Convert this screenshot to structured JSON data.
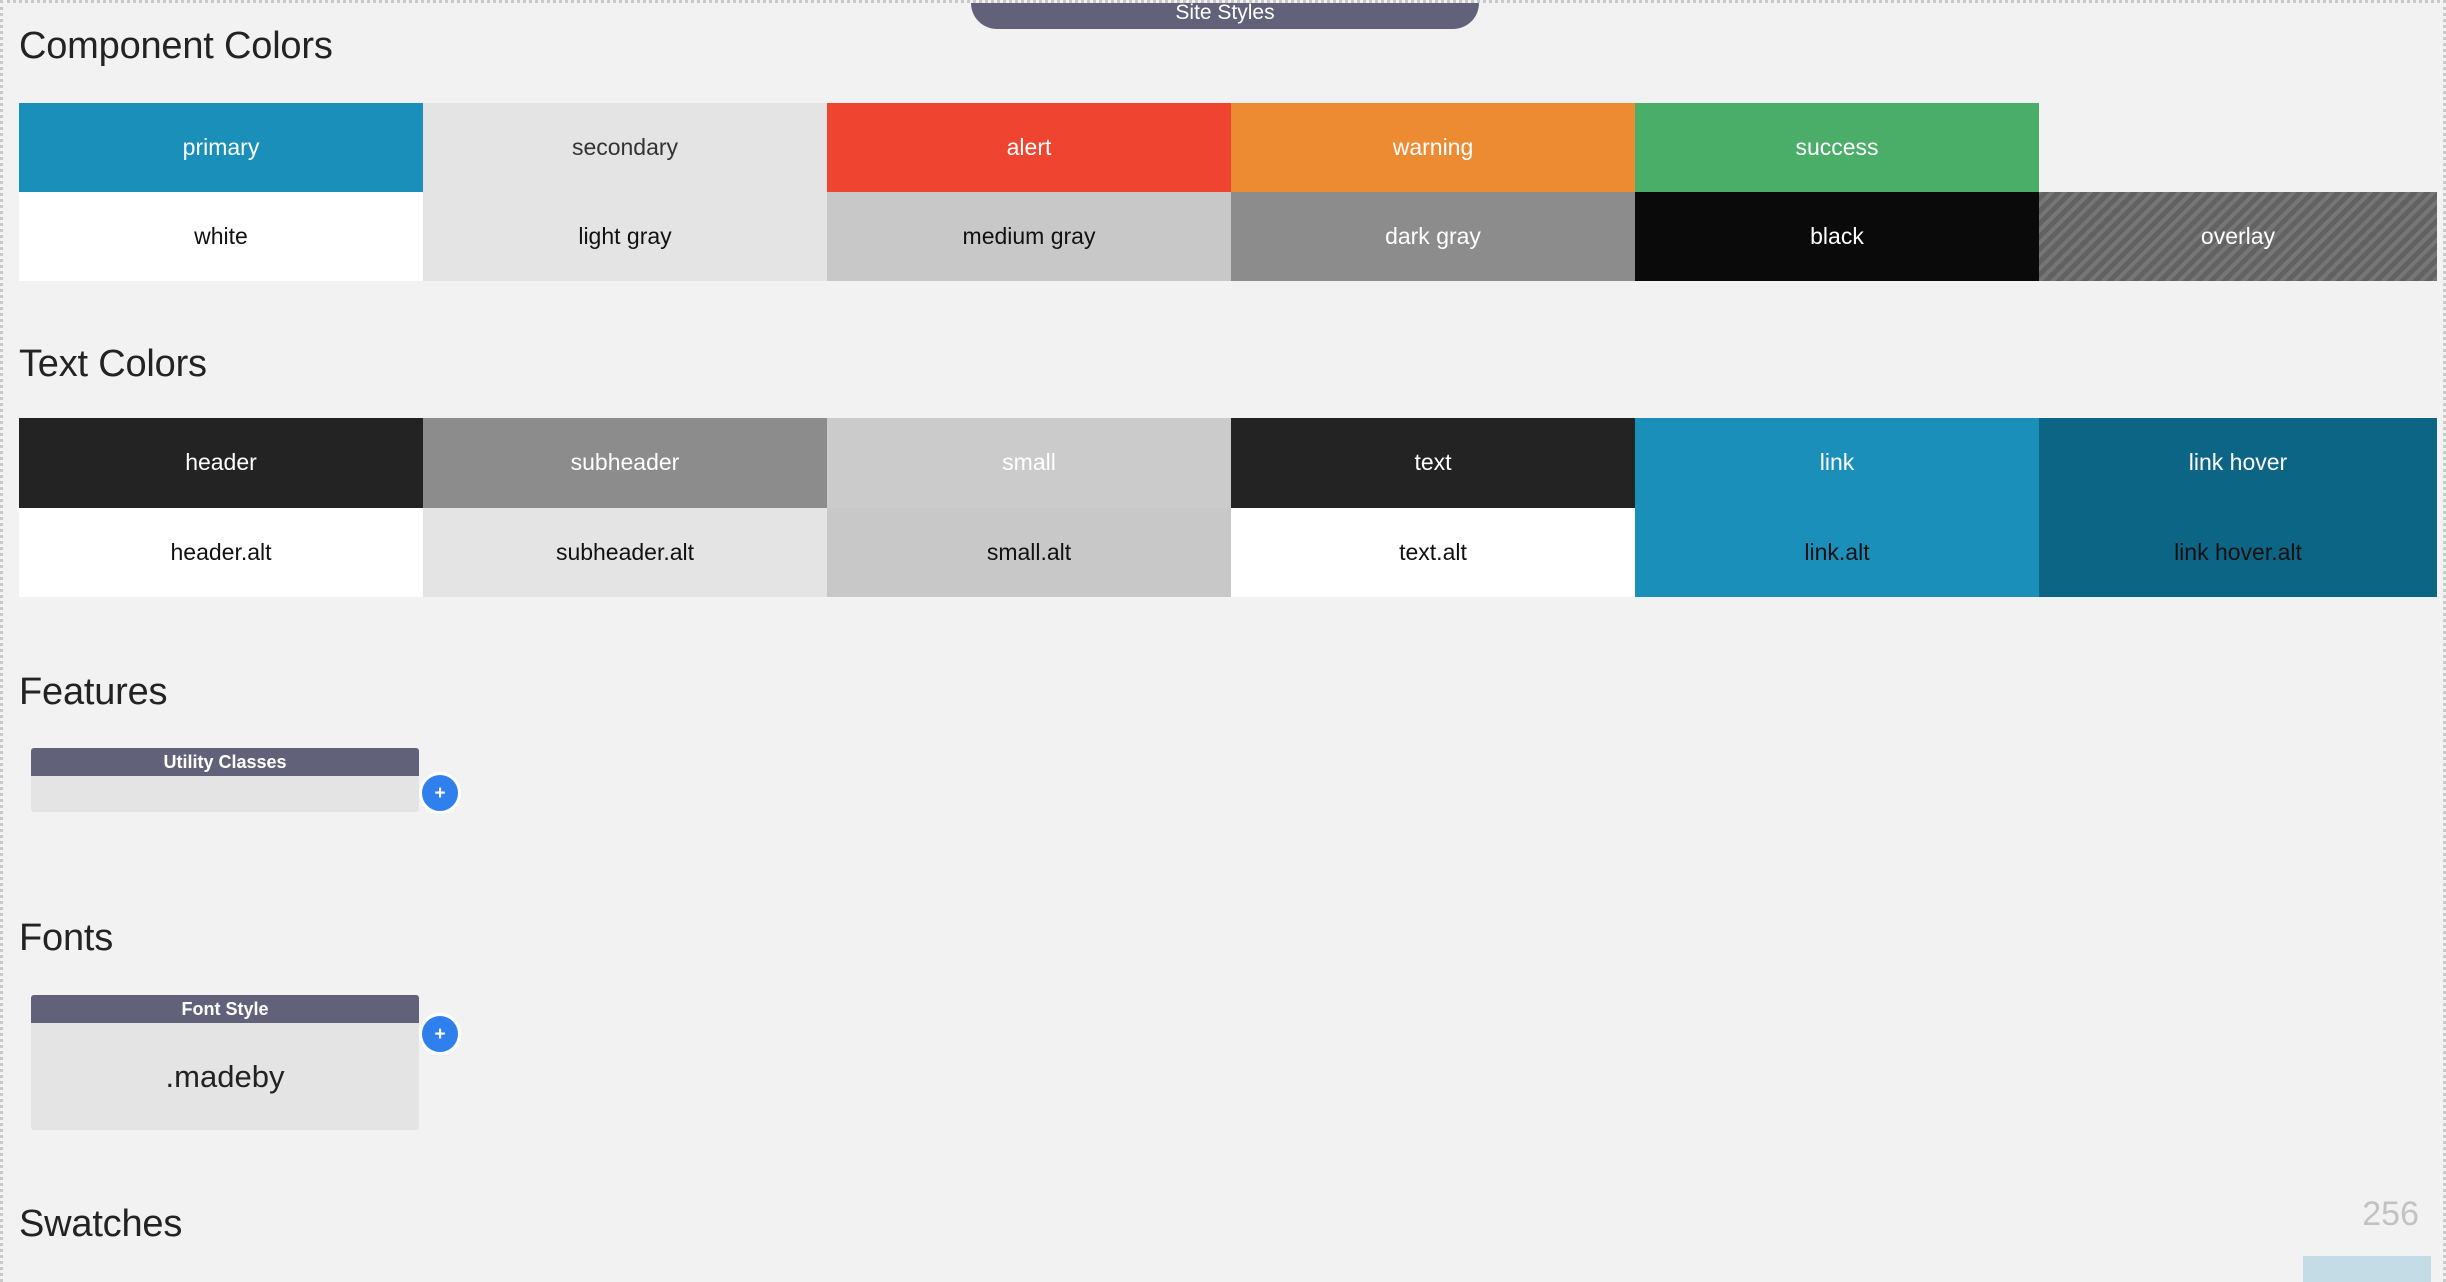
{
  "window": {
    "tab_label": "Site Styles",
    "background": "#f2f2f2"
  },
  "sections": {
    "component_colors": {
      "title": "Component Colors",
      "cells": [
        {
          "top_label": "primary",
          "top_color": "#1a8fba",
          "top_text": "#ffffff",
          "bottom_label": "white",
          "bottom_color": "#ffffff",
          "bottom_text": "#111111"
        },
        {
          "top_label": "secondary",
          "top_color": "#e4e4e4",
          "top_text": "#333333",
          "bottom_label": "light gray",
          "bottom_color": "#e4e4e4",
          "bottom_text": "#111111"
        },
        {
          "top_label": "alert",
          "top_color": "#ee4430",
          "top_text": "#ffffff",
          "bottom_label": "medium gray",
          "bottom_color": "#c8c8c8",
          "bottom_text": "#111111"
        },
        {
          "top_label": "warning",
          "top_color": "#ed8b33",
          "top_text": "#ffffff",
          "bottom_label": "dark gray",
          "bottom_color": "#8c8c8c",
          "bottom_text": "#ffffff"
        },
        {
          "top_label": "success",
          "top_color": "#4aad68",
          "top_text": "#ffffff",
          "bottom_label": "black",
          "bottom_color": "#0a0a0a",
          "bottom_text": "#ffffff"
        },
        {
          "top_label": "",
          "top_color": "#f2f2f2",
          "top_text": "#f2f2f2",
          "bottom_label": "overlay",
          "bottom_color": "#626262",
          "bottom_text": "#ffffff"
        }
      ]
    },
    "text_colors": {
      "title": "Text Colors",
      "cells": [
        {
          "top_label": "header",
          "top_color": "#232323",
          "top_text": "#ffffff",
          "bottom_label": "header.alt",
          "bottom_color": "#ffffff",
          "bottom_text": "#111111"
        },
        {
          "top_label": "subheader",
          "top_color": "#8c8c8c",
          "top_text": "#ffffff",
          "bottom_label": "subheader.alt",
          "bottom_color": "#e4e4e4",
          "bottom_text": "#111111"
        },
        {
          "top_label": "small",
          "top_color": "#cbcbcb",
          "top_text": "#ffffff",
          "bottom_label": "small.alt",
          "bottom_color": "#c8c8c8",
          "bottom_text": "#111111"
        },
        {
          "top_label": "text",
          "top_color": "#232323",
          "top_text": "#ffffff",
          "bottom_label": "text.alt",
          "bottom_color": "#ffffff",
          "bottom_text": "#111111"
        },
        {
          "top_label": "link",
          "top_color": "#1a8fba",
          "top_text": "#ffffff",
          "bottom_label": "link.alt",
          "bottom_color": "#1a8fba",
          "bottom_text": "#111111"
        },
        {
          "top_label": "link hover",
          "top_color": "#0d6585",
          "top_text": "#ffffff",
          "bottom_label": "link hover.alt",
          "bottom_color": "#0d6585",
          "bottom_text": "#111111"
        }
      ]
    },
    "features": {
      "title": "Features",
      "card_head": "Utility Classes",
      "card_body": "",
      "add_label": "+"
    },
    "fonts": {
      "title": "Fonts",
      "card_head": "Font Style",
      "card_body": ".madeby",
      "add_label": "+"
    },
    "swatches": {
      "title": "Swatches",
      "count": "256",
      "chip_color": "#c3dce5"
    }
  }
}
